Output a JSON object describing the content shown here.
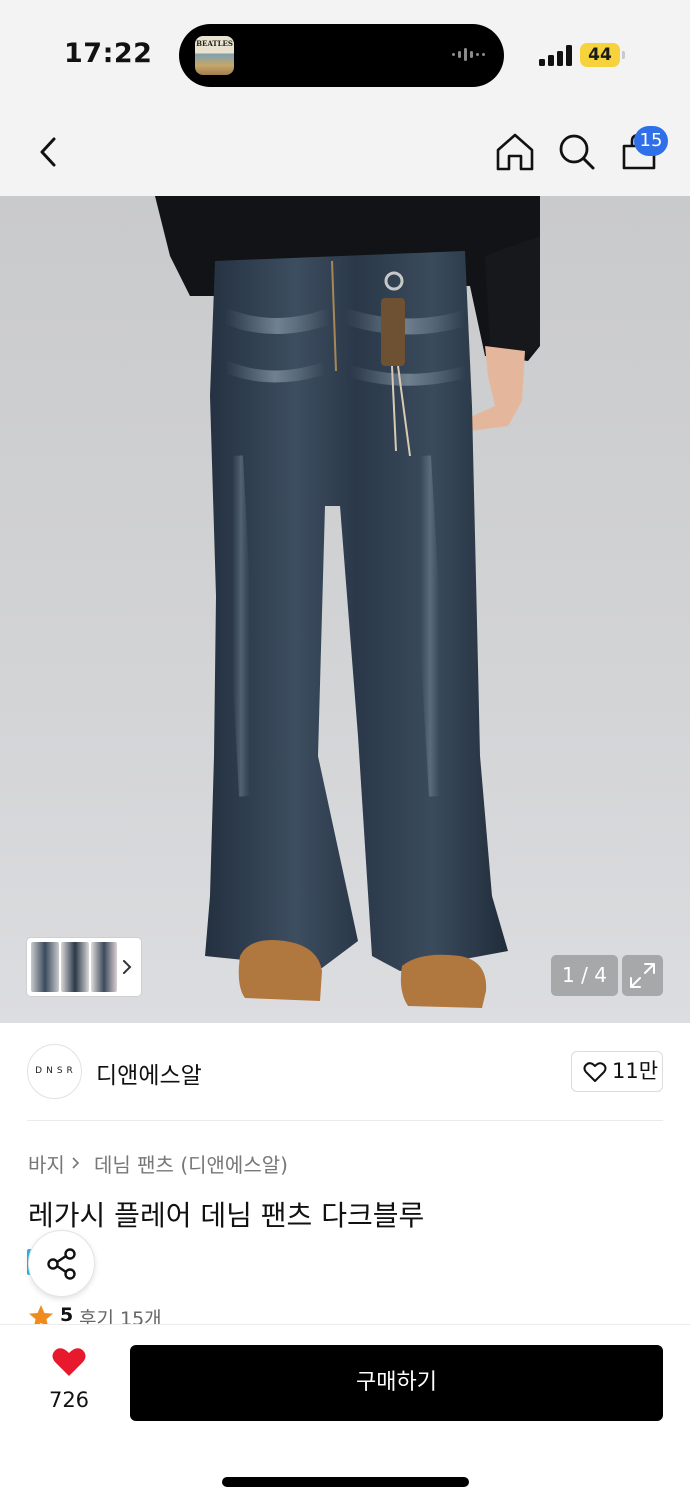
{
  "status_bar": {
    "time": "17:22",
    "now_playing_art_title": "BEATLES",
    "battery_level": "44",
    "icons": [
      "signal-icon",
      "battery-icon",
      "waveform-icon"
    ]
  },
  "header": {
    "icons": [
      "back-chevron-icon",
      "home-icon",
      "search-icon",
      "shopping-bag-icon"
    ],
    "cart_count": "15"
  },
  "gallery": {
    "counter": "1 / 4",
    "icons": [
      "chevron-right-icon",
      "expand-icon"
    ]
  },
  "brand": {
    "logo_text": "DNSR",
    "name": "디앤에스알",
    "likes": "11만"
  },
  "product": {
    "breadcrumb": [
      "바지",
      "데님 팬츠 (디앤에스알)"
    ],
    "title": "레가시 플레어 데님 팬츠 다크블루",
    "rating": "5",
    "reviews": "후기 15개"
  },
  "bottom_bar": {
    "like_count": "726",
    "buy_label": "구매하기"
  },
  "colors": {
    "accent_badge": "#2f6fe8",
    "heart": "#e8192c",
    "star": "#f08c1e",
    "buy_button": "#000000"
  }
}
